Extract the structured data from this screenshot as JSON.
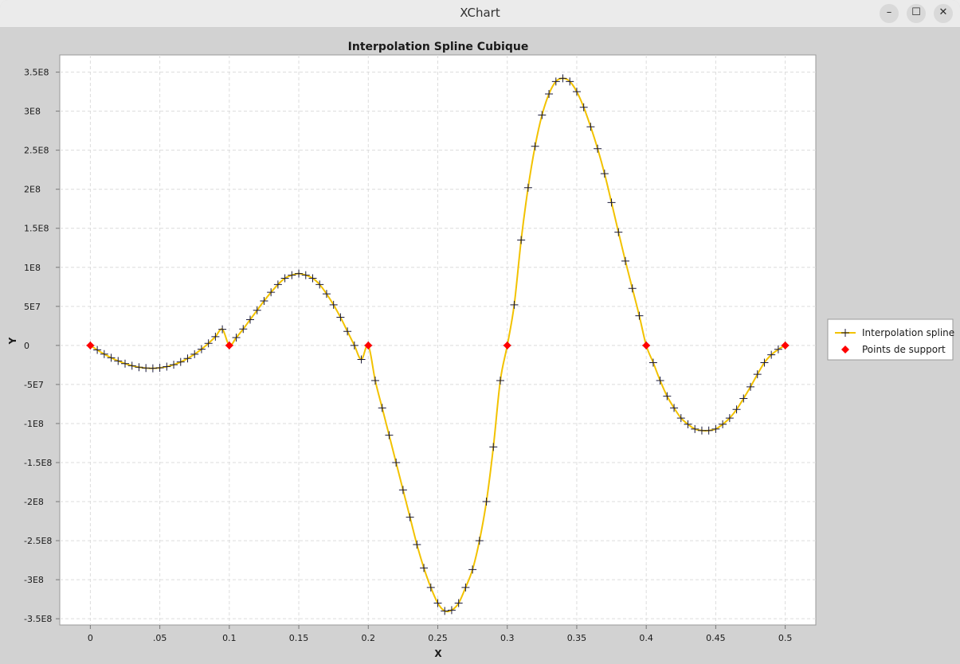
{
  "window": {
    "title": "XChart",
    "minimize_symbol": "–",
    "maximize_symbol": "☐",
    "close_symbol": "✕"
  },
  "chart_data": {
    "type": "line",
    "title": "Interpolation Spline Cubique",
    "xlabel": "X",
    "ylabel": "Y",
    "xlim": [
      -0.022,
      0.522
    ],
    "ylim": [
      -358000000.0,
      372000000.0
    ],
    "x_ticks": [
      {
        "v": 0,
        "label": "0"
      },
      {
        "v": 0.05,
        "label": ".05"
      },
      {
        "v": 0.1,
        "label": "0.1"
      },
      {
        "v": 0.15,
        "label": "0.15"
      },
      {
        "v": 0.2,
        "label": "0.2"
      },
      {
        "v": 0.25,
        "label": "0.25"
      },
      {
        "v": 0.3,
        "label": "0.3"
      },
      {
        "v": 0.35,
        "label": "0.35"
      },
      {
        "v": 0.4,
        "label": "0.4"
      },
      {
        "v": 0.45,
        "label": "0.45"
      },
      {
        "v": 0.5,
        "label": "0.5"
      }
    ],
    "y_ticks": [
      {
        "v": 350000000,
        "label": "3.5E8"
      },
      {
        "v": 300000000,
        "label": "3E8"
      },
      {
        "v": 250000000,
        "label": "2.5E8"
      },
      {
        "v": 200000000,
        "label": "2E8"
      },
      {
        "v": 150000000,
        "label": "1.5E8"
      },
      {
        "v": 100000000,
        "label": "1E8"
      },
      {
        "v": 50000000,
        "label": "5E7"
      },
      {
        "v": 0,
        "label": "0"
      },
      {
        "v": -50000000,
        "label": "-5E7"
      },
      {
        "v": -100000000,
        "label": "-1E8"
      },
      {
        "v": -150000000,
        "label": "-1.5E8"
      },
      {
        "v": -200000000,
        "label": "-2E8"
      },
      {
        "v": -250000000,
        "label": "-2.5E8"
      },
      {
        "v": -300000000,
        "label": "-3E8"
      },
      {
        "v": -350000000,
        "label": "-3.5E8"
      }
    ],
    "grid": true,
    "legend_position": "right",
    "line_color": "#f2c200",
    "marker_color": "#1a1a3a",
    "support_color": "#ff0000",
    "series": [
      {
        "name": "Interpolation spline",
        "style": "line-with-cross-markers",
        "x": [
          0,
          0.005,
          0.01,
          0.015,
          0.02,
          0.025,
          0.03,
          0.035,
          0.04,
          0.045,
          0.05,
          0.055,
          0.06,
          0.065,
          0.07,
          0.075,
          0.08,
          0.085,
          0.09,
          0.095,
          0.1,
          0.105,
          0.11,
          0.115,
          0.12,
          0.125,
          0.13,
          0.135,
          0.14,
          0.145,
          0.15,
          0.155,
          0.16,
          0.165,
          0.17,
          0.175,
          0.18,
          0.185,
          0.19,
          0.195,
          0.2,
          0.205,
          0.21,
          0.215,
          0.22,
          0.225,
          0.23,
          0.235,
          0.24,
          0.245,
          0.25,
          0.255,
          0.26,
          0.265,
          0.27,
          0.275,
          0.28,
          0.285,
          0.29,
          0.295,
          0.3,
          0.305,
          0.31,
          0.315,
          0.32,
          0.325,
          0.33,
          0.335,
          0.34,
          0.345,
          0.35,
          0.355,
          0.36,
          0.365,
          0.37,
          0.375,
          0.38,
          0.385,
          0.39,
          0.395,
          0.4,
          0.405,
          0.41,
          0.415,
          0.42,
          0.425,
          0.43,
          0.435,
          0.44,
          0.445,
          0.45,
          0.455,
          0.46,
          0.465,
          0.47,
          0.475,
          0.48,
          0.485,
          0.49,
          0.495,
          0.5
        ],
        "y": [
          0,
          -5800000,
          -11100000,
          -15800000,
          -19900000,
          -23300000,
          -26000000,
          -27900000,
          -29000000,
          -29300000,
          -28700000,
          -27200000,
          -24700000,
          -21200000,
          -16700000,
          -11200000,
          -4800000,
          2700000,
          11200000,
          20700000,
          0,
          10000000,
          21000000,
          33000000,
          45000000,
          57000000,
          68000000,
          78000000,
          86000000,
          90000000,
          92000000,
          90000000,
          86000000,
          78000000,
          66000000,
          52000000,
          36000000,
          18000000,
          0,
          -18000000,
          0,
          -45000000,
          -80000000,
          -115000000,
          -150000000,
          -185000000,
          -220000000,
          -255000000,
          -285000000,
          -310000000,
          -330000000,
          -340000000,
          -339000000,
          -330000000,
          -310000000,
          -287000000,
          -250000000,
          -200000000,
          -130000000,
          -45000000,
          0,
          52000000,
          135000000,
          202000000,
          255000000,
          295000000,
          322000000,
          338000000,
          342000000,
          338000000,
          325000000,
          305000000,
          280000000,
          252000000,
          220000000,
          183000000,
          145000000,
          108000000,
          73000000,
          38000000,
          0,
          -22000000,
          -45000000,
          -65000000,
          -80000000,
          -93000000,
          -101000000,
          -107000000,
          -109000000,
          -109000000,
          -107000000,
          -101000000,
          -93000000,
          -82000000,
          -68000000,
          -53000000,
          -37000000,
          -22000000,
          -12000000,
          -5000000,
          0
        ]
      },
      {
        "name": "Points de support",
        "style": "diamond-markers",
        "x": [
          0,
          0.1,
          0.2,
          0.3,
          0.4,
          0.5
        ],
        "y": [
          0,
          0,
          0,
          0,
          0,
          0
        ]
      }
    ]
  }
}
